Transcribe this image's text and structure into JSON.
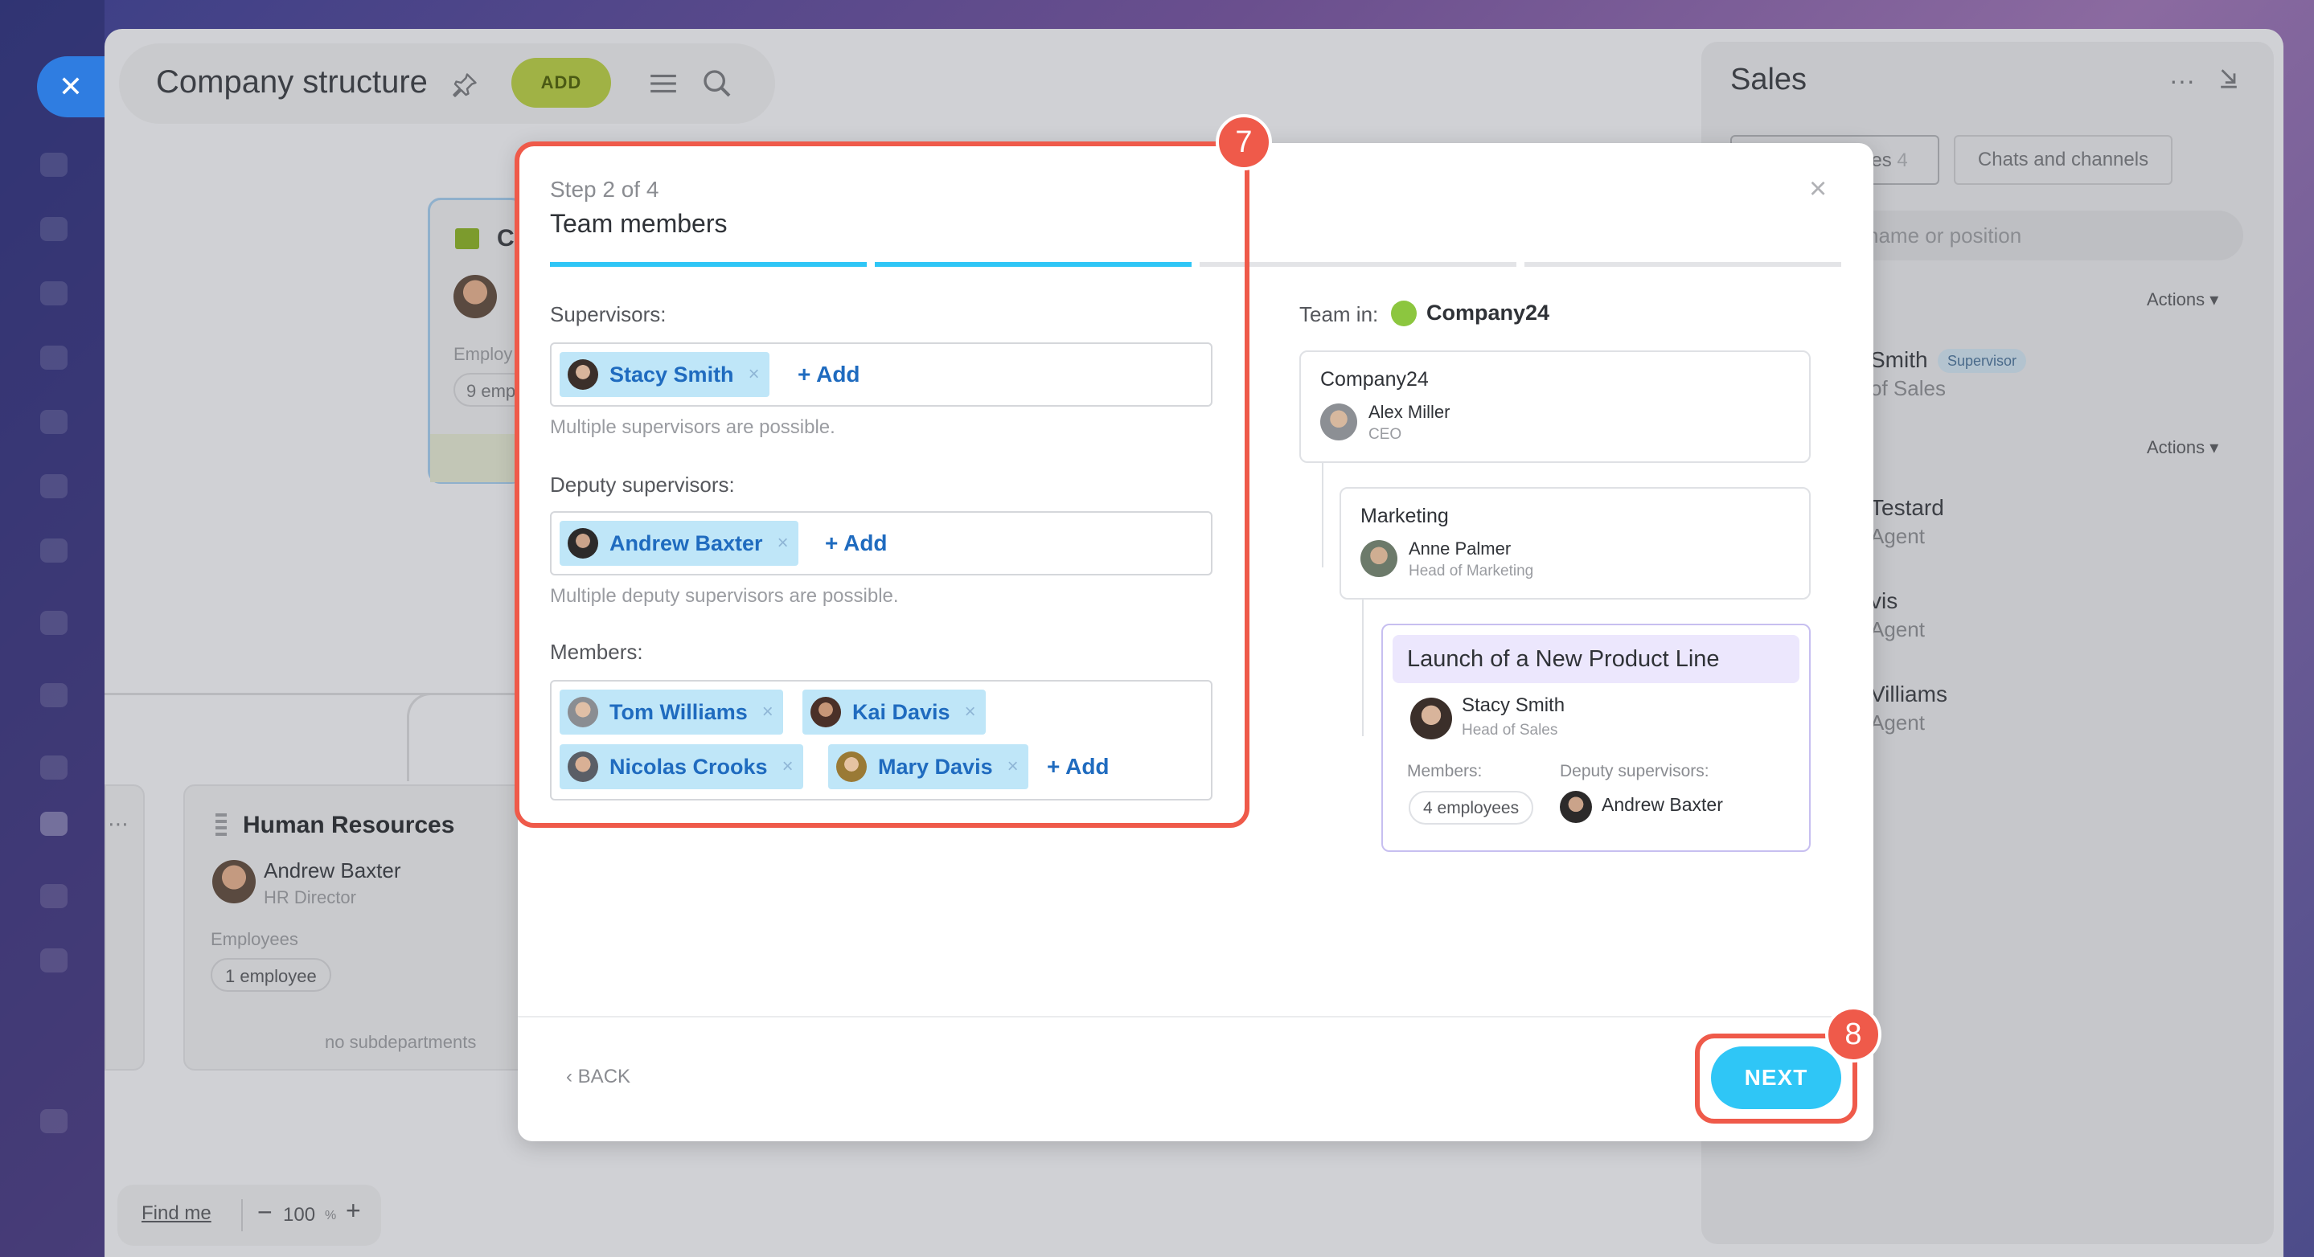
{
  "window": {
    "title": "Company structure",
    "add_label": "ADD"
  },
  "background": {
    "top_card_letter": "C",
    "top_card_emp_label": "Employ",
    "top_card_emp_pill": "9 emp",
    "hr_card": {
      "title": "Human Resources",
      "name": "Andrew Baxter",
      "role": "HR Director",
      "emp_label": "Employees",
      "emp_pill": "1 employee",
      "no_sub": "no subdepartments"
    },
    "zoom": {
      "find_me": "Find me",
      "minus": "−",
      "value": "100",
      "unit": "%",
      "plus": "+"
    }
  },
  "sales_panel": {
    "title": "Sales",
    "more": "···",
    "tab_employees": "ees",
    "tab_employees_count": "4",
    "tab_chats": "Chats and channels",
    "search_placeholder": "name or position",
    "actions_1": "Actions",
    "actions_2": "Actions",
    "rows": [
      {
        "name": "Smith",
        "sub": "of Sales",
        "badge": "Supervisor"
      },
      {
        "name": "Testard",
        "sub": "Agent"
      },
      {
        "name": "vis",
        "sub": "Agent"
      },
      {
        "name": "Villiams",
        "sub": "Agent"
      }
    ]
  },
  "dialog": {
    "step": "Step 2 of 4",
    "title": "Team members",
    "close": "×",
    "progress_steps_total": 4,
    "progress_steps_done": 2,
    "supervisors": {
      "label": "Supervisors:",
      "chips": [
        "Stacy Smith"
      ],
      "add": "+ Add",
      "hint": "Multiple supervisors are possible."
    },
    "deputies": {
      "label": "Deputy supervisors:",
      "chips": [
        "Andrew Baxter"
      ],
      "add": "+ Add",
      "hint": "Multiple deputy supervisors are possible."
    },
    "members": {
      "label": "Members:",
      "chips": [
        "Tom Williams",
        "Kai Davis",
        "Nicolas Crooks",
        "Mary Davis"
      ],
      "add": "+ Add"
    },
    "chip_remove": "×",
    "preview": {
      "team_in_label": "Team in:",
      "team_in_name": "Company24",
      "company": {
        "title": "Company24",
        "name": "Alex Miller",
        "role": "CEO"
      },
      "dept": {
        "title": "Marketing",
        "name": "Anne Palmer",
        "role": "Head of Marketing"
      },
      "new_team": {
        "title": "Launch of a New Product Line",
        "name": "Stacy Smith",
        "role": "Head of Sales",
        "members_label": "Members:",
        "members_value": "4 employees",
        "deputy_label": "Deputy supervisors:",
        "deputy_name": "Andrew Baxter"
      }
    },
    "back": "BACK",
    "next": "NEXT"
  },
  "callouts": {
    "step7": "7",
    "step8": "8"
  },
  "colors": {
    "accent": "#2fc6f6",
    "chip_bg": "#bfe6f8",
    "chip_text": "#1f6bbf",
    "callout": "#ef5a4a",
    "add_btn": "#a0b245"
  }
}
